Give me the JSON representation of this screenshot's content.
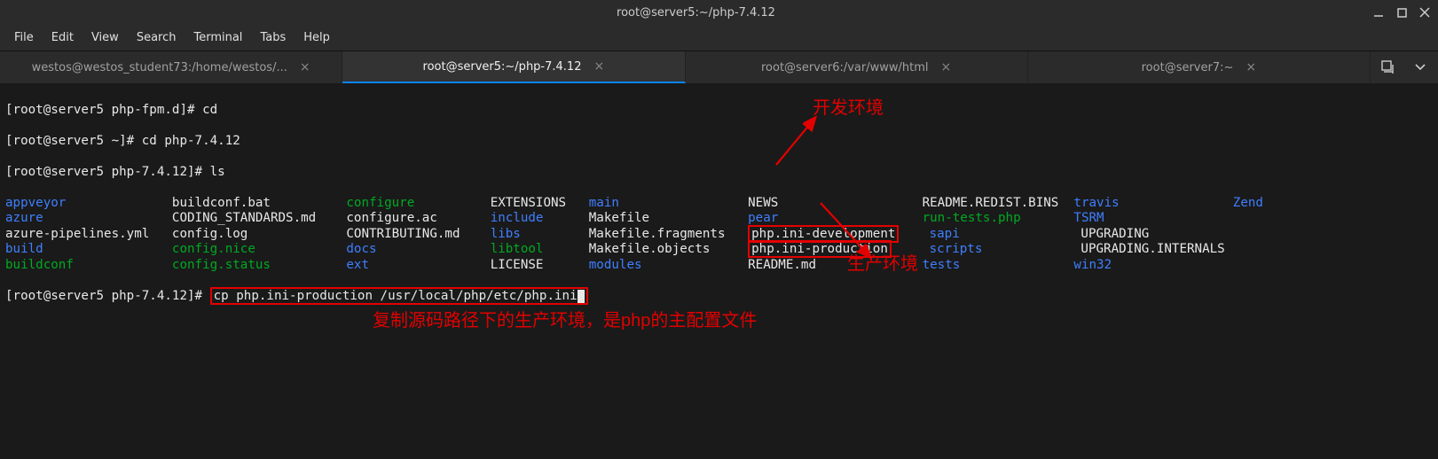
{
  "window": {
    "title": "root@server5:~/php-7.4.12"
  },
  "menu": {
    "file": "File",
    "edit": "Edit",
    "view": "View",
    "search": "Search",
    "terminal": "Terminal",
    "tabs": "Tabs",
    "help": "Help"
  },
  "tabs": {
    "t0": "westos@westos_student73:/home/westos/...",
    "t1": "root@server5:~/php-7.4.12",
    "t2": "root@server6:/var/www/html",
    "t3": "root@server7:~"
  },
  "term": {
    "l1a": "[root@server5 php-fpm.d]# ",
    "l1b": "cd",
    "l2a": "[root@server5 ~]# ",
    "l2b": "cd php-7.4.12",
    "l3a": "[root@server5 php-7.4.12]# ",
    "l3b": "ls",
    "ls": {
      "c1r1": "appveyor",
      "c2r1": "buildconf.bat",
      "c3r1": "configure",
      "c4r1": "EXTENSIONS",
      "c5r1": "main",
      "c6r1": "NEWS",
      "c7r1": "README.REDIST.BINS",
      "c8r1": "travis",
      "c9r1": "Zend",
      "c1r2": "azure",
      "c2r2": "CODING_STANDARDS.md",
      "c3r2": "configure.ac",
      "c4r2": "include",
      "c5r2": "Makefile",
      "c6r2": "pear",
      "c7r2": "run-tests.php",
      "c8r2": "TSRM",
      "c1r3": "azure-pipelines.yml",
      "c2r3": "config.log",
      "c3r3": "CONTRIBUTING.md",
      "c4r3": "libs",
      "c5r3": "Makefile.fragments",
      "c6r3": "php.ini-development",
      "c7r3": "sapi",
      "c8r3": "UPGRADING",
      "c1r4": "build",
      "c2r4": "config.nice",
      "c3r4": "docs",
      "c4r4": "libtool",
      "c5r4": "Makefile.objects",
      "c6r4": "php.ini-production",
      "c7r4": "scripts",
      "c8r4": "UPGRADING.INTERNALS",
      "c1r5": "buildconf",
      "c2r5": "config.status",
      "c3r5": "ext",
      "c4r5": "LICENSE",
      "c5r5": "modules",
      "c6r5": "README.md",
      "c7r5": "tests",
      "c8r5": "win32"
    },
    "l4a": "[root@server5 php-7.4.12]# ",
    "l4b": "cp php.ini-production /usr/local/php/etc/php.ini"
  },
  "annotations": {
    "dev_env": "开发环境",
    "prod_env": "生产环境",
    "copy_text": "复制源码路径下的生产环境，是php的主配置文件"
  }
}
